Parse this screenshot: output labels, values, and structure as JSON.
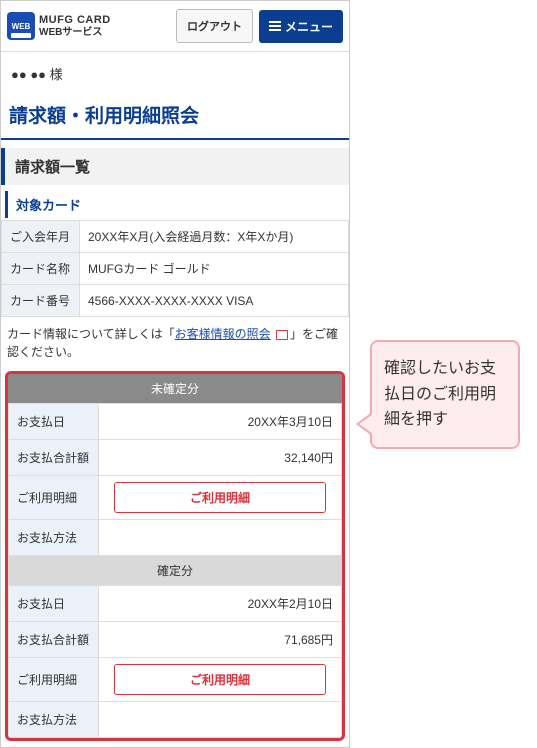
{
  "header": {
    "brand_line1": "MUFG CARD",
    "brand_line2": "WEBサービス",
    "logo_badge": "WEB",
    "logout": "ログアウト",
    "menu": "メニュー"
  },
  "greeting": "●● ●● 様",
  "page_title": "請求額・利用明細照会",
  "section_title": "請求額一覧",
  "sub_title": "対象カード",
  "card_info": {
    "rows": [
      {
        "label": "ご入会年月",
        "value": "20XX年X月(入会経過月数：X年Xか月)"
      },
      {
        "label": "カード名称",
        "value": "MUFGカード ゴールド"
      },
      {
        "label": "カード番号",
        "value": "4566-XXXX-XXXX-XXXX VISA"
      }
    ]
  },
  "note": {
    "pre": "カード情報について詳しくは「",
    "link": "お客様情報の照会",
    "post": "」をご確認ください。"
  },
  "billing": {
    "pending": {
      "title": "未確定分",
      "rows": {
        "pay_date_label": "お支払日",
        "pay_date_value": "20XX年3月10日",
        "total_label": "お支払合計額",
        "total_value": "32,140円",
        "detail_label": "ご利用明細",
        "detail_button": "ご利用明細",
        "method_label": "お支払方法",
        "method_value": ""
      }
    },
    "fixed": {
      "title": "確定分",
      "rows": {
        "pay_date_label": "お支払日",
        "pay_date_value": "20XX年2月10日",
        "total_label": "お支払合計額",
        "total_value": "71,685円",
        "detail_label": "ご利用明細",
        "detail_button": "ご利用明細",
        "method_label": "お支払方法",
        "method_value": ""
      }
    }
  },
  "callout": "確認したいお支払日のご利用明細を押す"
}
